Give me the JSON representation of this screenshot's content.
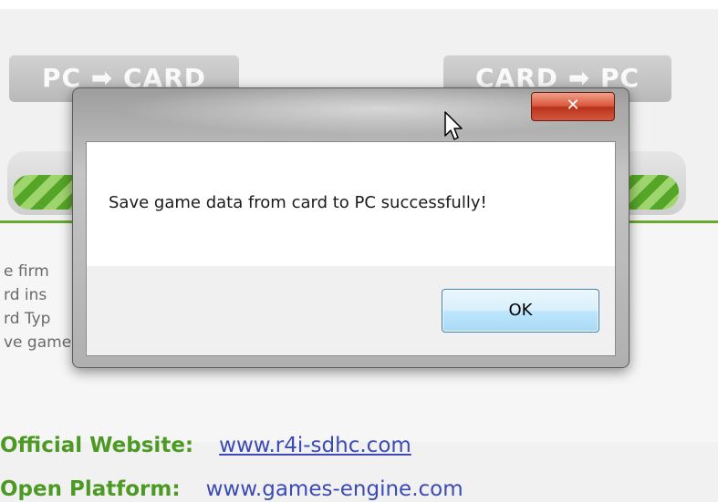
{
  "app": {
    "buttons": {
      "pc_to_card": "PC ➡ CARD",
      "card_to_pc": "CARD ➡ PC"
    },
    "log_lines": [
      "e firm",
      "rd ins",
      "rd Typ",
      "ve game data from card to PC successfully!"
    ],
    "footer": {
      "website_label": "Official Website:",
      "website_link": "www.r4i-sdhc.com",
      "platform_label": "Open Platform:",
      "platform_link": "www.games-engine.com"
    },
    "colors": {
      "accent_green": "#6aa82f",
      "link_blue": "#3b4bb2"
    }
  },
  "dialog": {
    "message": "Save game data from card to PC successfully!",
    "ok_label": "OK",
    "close_icon": "close-icon"
  },
  "progress": {
    "fraction": 1.0
  }
}
